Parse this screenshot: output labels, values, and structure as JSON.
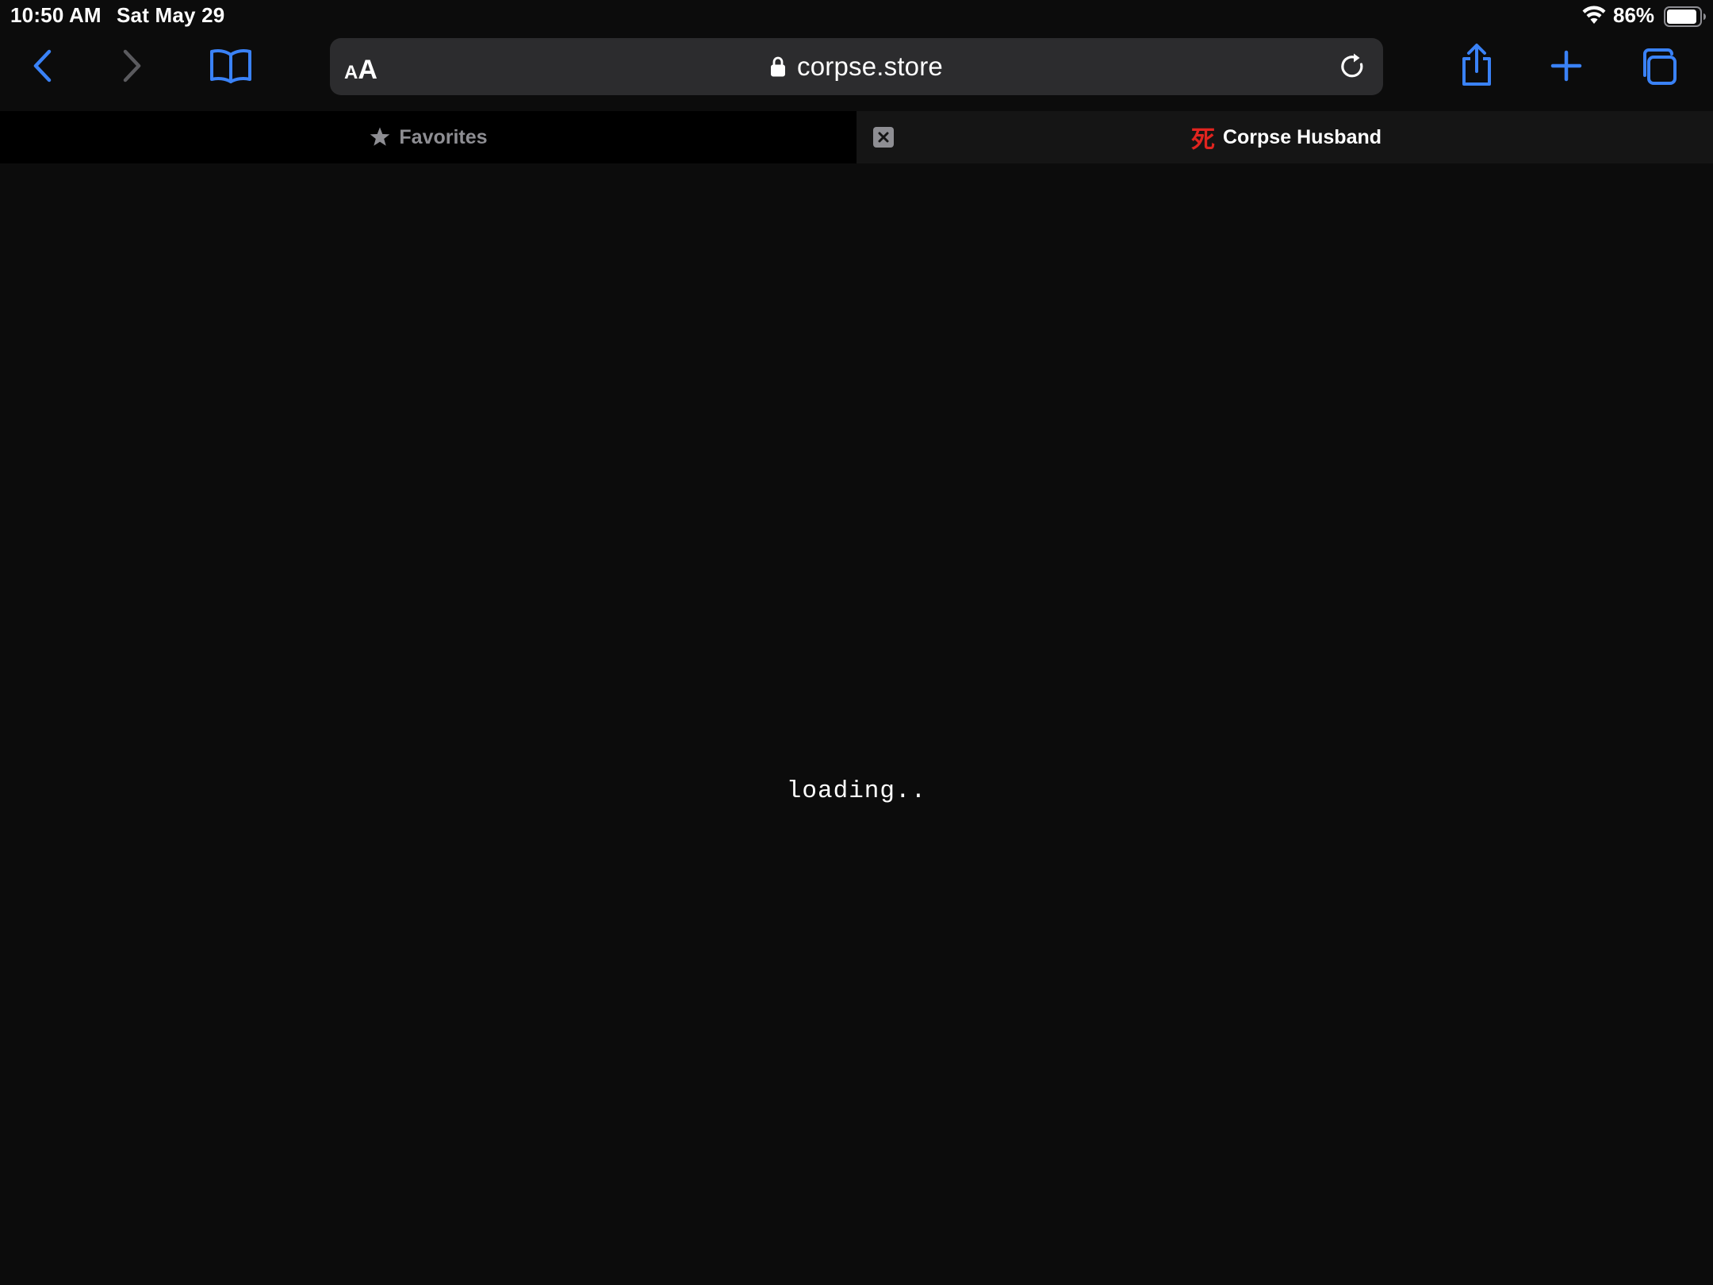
{
  "status_bar": {
    "time": "10:50 AM",
    "date": "Sat May 29",
    "battery_percent": "86%",
    "battery_level": 0.86,
    "wifi_icon": "wifi-icon",
    "battery_icon": "battery-icon"
  },
  "toolbar": {
    "back_icon": "chevron-left-icon",
    "forward_icon": "chevron-right-icon",
    "bookmarks_icon": "book-icon",
    "share_icon": "share-icon",
    "new_tab_icon": "plus-icon",
    "tabs_icon": "tabs-overview-icon",
    "accent_color": "#3a82f7"
  },
  "address_bar": {
    "reader_small": "A",
    "reader_large": "A",
    "url": "corpse.store",
    "secure": true,
    "reload_icon": "reload-icon"
  },
  "tabs": [
    {
      "label": "Favorites",
      "icon": "star-icon",
      "active": false
    },
    {
      "label": "Corpse Husband",
      "favicon": "死",
      "favicon_color": "#e0241f",
      "active": true,
      "close_icon": "close-icon"
    }
  ],
  "page": {
    "loading_text": "loading.."
  }
}
